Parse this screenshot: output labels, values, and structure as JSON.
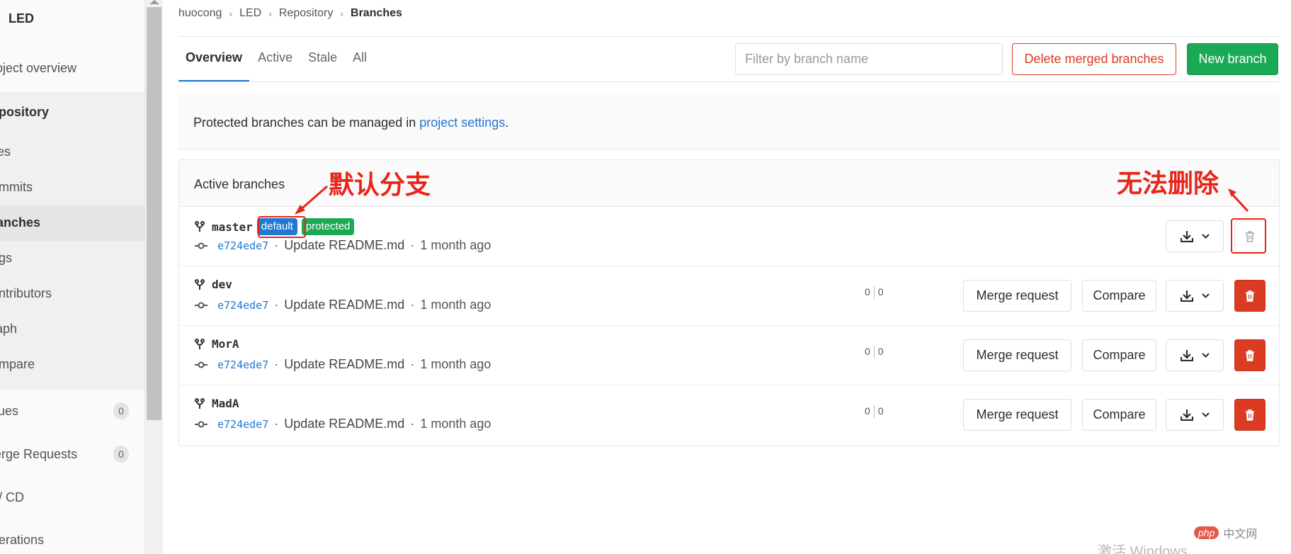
{
  "sidebar": {
    "title": "LED",
    "items": [
      {
        "label": "roject overview"
      },
      {
        "label": "epository"
      },
      {
        "label": "iles"
      },
      {
        "label": "ommits"
      },
      {
        "label": "ranches"
      },
      {
        "label": "ags"
      },
      {
        "label": "ontributors"
      },
      {
        "label": "raph"
      },
      {
        "label": "ompare"
      },
      {
        "label": "sues",
        "badge": "0"
      },
      {
        "label": "lerge Requests",
        "badge": "0"
      },
      {
        "label": "I / CD"
      },
      {
        "label": "perations"
      }
    ]
  },
  "breadcrumb": [
    "huocong",
    "LED",
    "Repository",
    "Branches"
  ],
  "tabs": [
    "Overview",
    "Active",
    "Stale",
    "All"
  ],
  "filter": {
    "placeholder": "Filter by branch name"
  },
  "buttons": {
    "delete_merged": "Delete merged branches",
    "new_branch": "New branch",
    "merge_request": "Merge request",
    "compare": "Compare"
  },
  "info": {
    "prefix": "Protected branches can be managed in ",
    "link": "project settings",
    "suffix": "."
  },
  "panel": {
    "title": "Active branches"
  },
  "branches": [
    {
      "name": "master",
      "badges": [
        "default",
        "protected"
      ],
      "sha": "e724ede7",
      "message": "Update README.md",
      "dot1": "·",
      "time": "1 month ago",
      "behind": "",
      "ahead": ""
    },
    {
      "name": "dev",
      "badges": [],
      "sha": "e724ede7",
      "message": "Update README.md",
      "dot1": "·",
      "time": "1 month ago",
      "behind": "0",
      "ahead": "0"
    },
    {
      "name": "MorA",
      "badges": [],
      "sha": "e724ede7",
      "message": "Update README.md",
      "dot1": "·",
      "time": "1 month ago",
      "behind": "0",
      "ahead": "0"
    },
    {
      "name": "MadA",
      "badges": [],
      "sha": "e724ede7",
      "message": "Update README.md",
      "dot1": "·",
      "time": "1 month ago",
      "behind": "0",
      "ahead": "0"
    }
  ],
  "annotations": {
    "default_branch": "默认分支",
    "cannot_delete": "无法删除"
  },
  "watermark": {
    "php": "php",
    "site": "中文网",
    "windows": "激活 Windows"
  },
  "colors": {
    "accent": "#1f78d1",
    "success": "#1aaa55",
    "danger": "#db3b21",
    "annotation": "#e8251a"
  }
}
